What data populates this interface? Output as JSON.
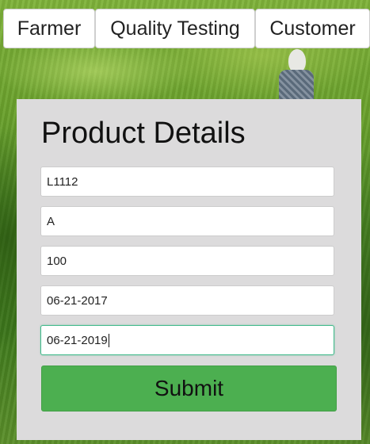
{
  "nav": {
    "tabs": [
      {
        "label": "Farmer"
      },
      {
        "label": "Quality Testing"
      },
      {
        "label": "Customer"
      }
    ]
  },
  "form": {
    "title": "Product Details",
    "fields": [
      {
        "value": "L1112"
      },
      {
        "value": "A"
      },
      {
        "value": "100"
      },
      {
        "value": "06-21-2017"
      },
      {
        "value": "06-21-2019",
        "focused": true
      }
    ],
    "submit_label": "Submit"
  },
  "colors": {
    "panel_bg": "#dcdbdc",
    "submit_bg": "#4caf50",
    "focus_border": "#3fb98a"
  }
}
